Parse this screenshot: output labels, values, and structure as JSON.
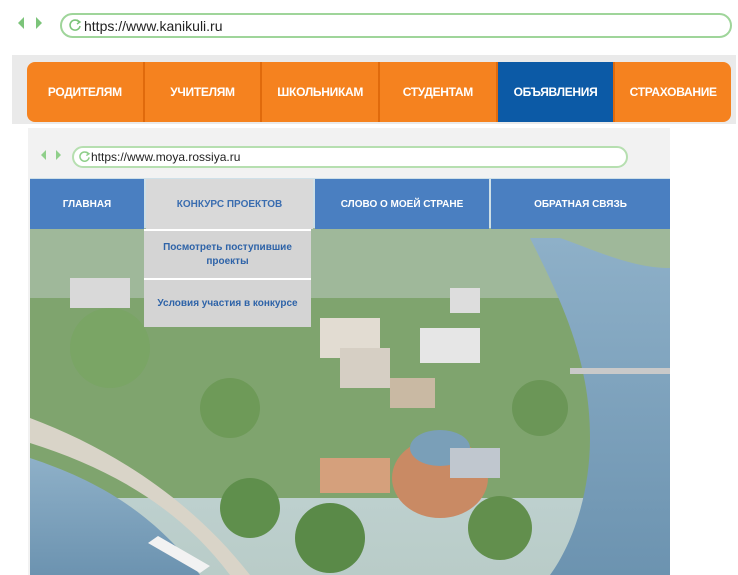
{
  "browser1": {
    "url": "https://www.kanikuli.ru",
    "menu": [
      {
        "label": "РОДИТЕЛЯМ"
      },
      {
        "label": "УЧИТЕЛЯМ"
      },
      {
        "label": "ШКОЛЬНИКАМ"
      },
      {
        "label": "СТУДЕНТАМ"
      },
      {
        "label": "ОБЪЯВЛЕНИЯ",
        "active": true
      },
      {
        "label": "СТРАХОВАНИЕ"
      }
    ],
    "colors": {
      "menu": "#f5821f",
      "active": "#0c5aa6"
    }
  },
  "browser2": {
    "url": "https://www.moya.rossiya.ru",
    "menu": [
      {
        "label": "ГЛАВНАЯ"
      },
      {
        "label": "КОНКУРС ПРОЕКТОВ",
        "active": true
      },
      {
        "label": "СЛОВО О МОЕЙ СТРАНЕ"
      },
      {
        "label": "ОБРАТНАЯ СВЯЗЬ"
      }
    ],
    "dropdown": [
      {
        "label": "Посмотреть поступившие проекты"
      },
      {
        "label": "Условия участия в конкурсе"
      }
    ],
    "colors": {
      "menu": "#4a7fc1",
      "active": "#d9d9d9"
    }
  }
}
